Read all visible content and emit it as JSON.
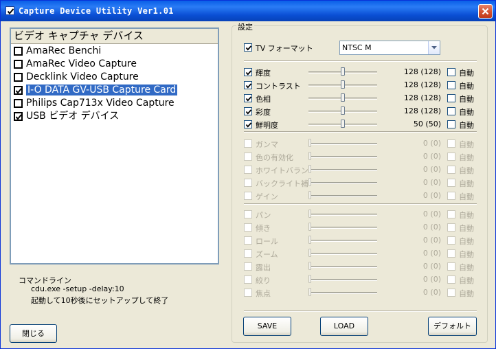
{
  "window": {
    "title": "Capture Device Utility  Ver1.01",
    "title_checked": true
  },
  "devices": {
    "header": "ビデオ キャプチャ デバイス",
    "items": [
      {
        "label": "AmaRec Benchi",
        "checked": false,
        "selected": false
      },
      {
        "label": "AmaRec Video Capture",
        "checked": false,
        "selected": false
      },
      {
        "label": "Decklink Video Capture",
        "checked": false,
        "selected": false
      },
      {
        "label": "I-O DATA GV-USB Capture Card",
        "checked": true,
        "selected": true
      },
      {
        "label": "Philips Cap713x Video Capture",
        "checked": false,
        "selected": false
      },
      {
        "label": "USB ビデオ デバイス",
        "checked": true,
        "selected": false
      }
    ]
  },
  "command": {
    "label": "コマンドライン",
    "line": "cdu.exe -setup -delay:10",
    "description": "起動して10秒後にセットアップして終了"
  },
  "buttons": {
    "close": "閉じる",
    "save": "SAVE",
    "load": "LOAD",
    "default": "デフォルト"
  },
  "settings": {
    "group_title": "設定",
    "tv_format": {
      "label": "TV フォーマット",
      "checked": true,
      "value": "NTSC M"
    },
    "auto_label": "自動",
    "image": [
      {
        "name": "輝度",
        "value": "128 (128)",
        "enabled": true,
        "checked": true,
        "level": 0.5
      },
      {
        "name": "コントラスト",
        "value": "128 (128)",
        "enabled": true,
        "checked": true,
        "level": 0.5
      },
      {
        "name": "色相",
        "value": "128 (128)",
        "enabled": true,
        "checked": true,
        "level": 0.5
      },
      {
        "name": "彩度",
        "value": "128 (128)",
        "enabled": true,
        "checked": true,
        "level": 0.5
      },
      {
        "name": "鮮明度",
        "value": "50 (50)",
        "enabled": true,
        "checked": true,
        "level": 0.5
      }
    ],
    "extra": [
      {
        "name": "ガンマ",
        "value": "0 (0)",
        "enabled": false,
        "checked": false,
        "level": 0
      },
      {
        "name": "色の有効化",
        "value": "0 (0)",
        "enabled": false,
        "checked": false,
        "level": 0
      },
      {
        "name": "ホワイトバランス",
        "value": "0 (0)",
        "enabled": false,
        "checked": false,
        "level": 0
      },
      {
        "name": "バックライト補正",
        "value": "0 (0)",
        "enabled": false,
        "checked": false,
        "level": 0
      },
      {
        "name": "ゲイン",
        "value": "0 (0)",
        "enabled": false,
        "checked": false,
        "level": 0
      }
    ],
    "camera": [
      {
        "name": "パン",
        "value": "0 (0)",
        "enabled": false,
        "checked": false,
        "level": 0
      },
      {
        "name": "傾き",
        "value": "0 (0)",
        "enabled": false,
        "checked": false,
        "level": 0
      },
      {
        "name": "ロール",
        "value": "0 (0)",
        "enabled": false,
        "checked": false,
        "level": 0
      },
      {
        "name": "ズーム",
        "value": "0 (0)",
        "enabled": false,
        "checked": false,
        "level": 0
      },
      {
        "name": "露出",
        "value": "0 (0)",
        "enabled": false,
        "checked": false,
        "level": 0
      },
      {
        "name": "絞り",
        "value": "0 (0)",
        "enabled": false,
        "checked": false,
        "level": 0
      },
      {
        "name": "焦点",
        "value": "0 (0)",
        "enabled": false,
        "checked": false,
        "level": 0
      }
    ]
  },
  "colors": {
    "titlebar": "#0a5fe7",
    "selection": "#316ac5",
    "window_bg": "#ece9d8"
  }
}
